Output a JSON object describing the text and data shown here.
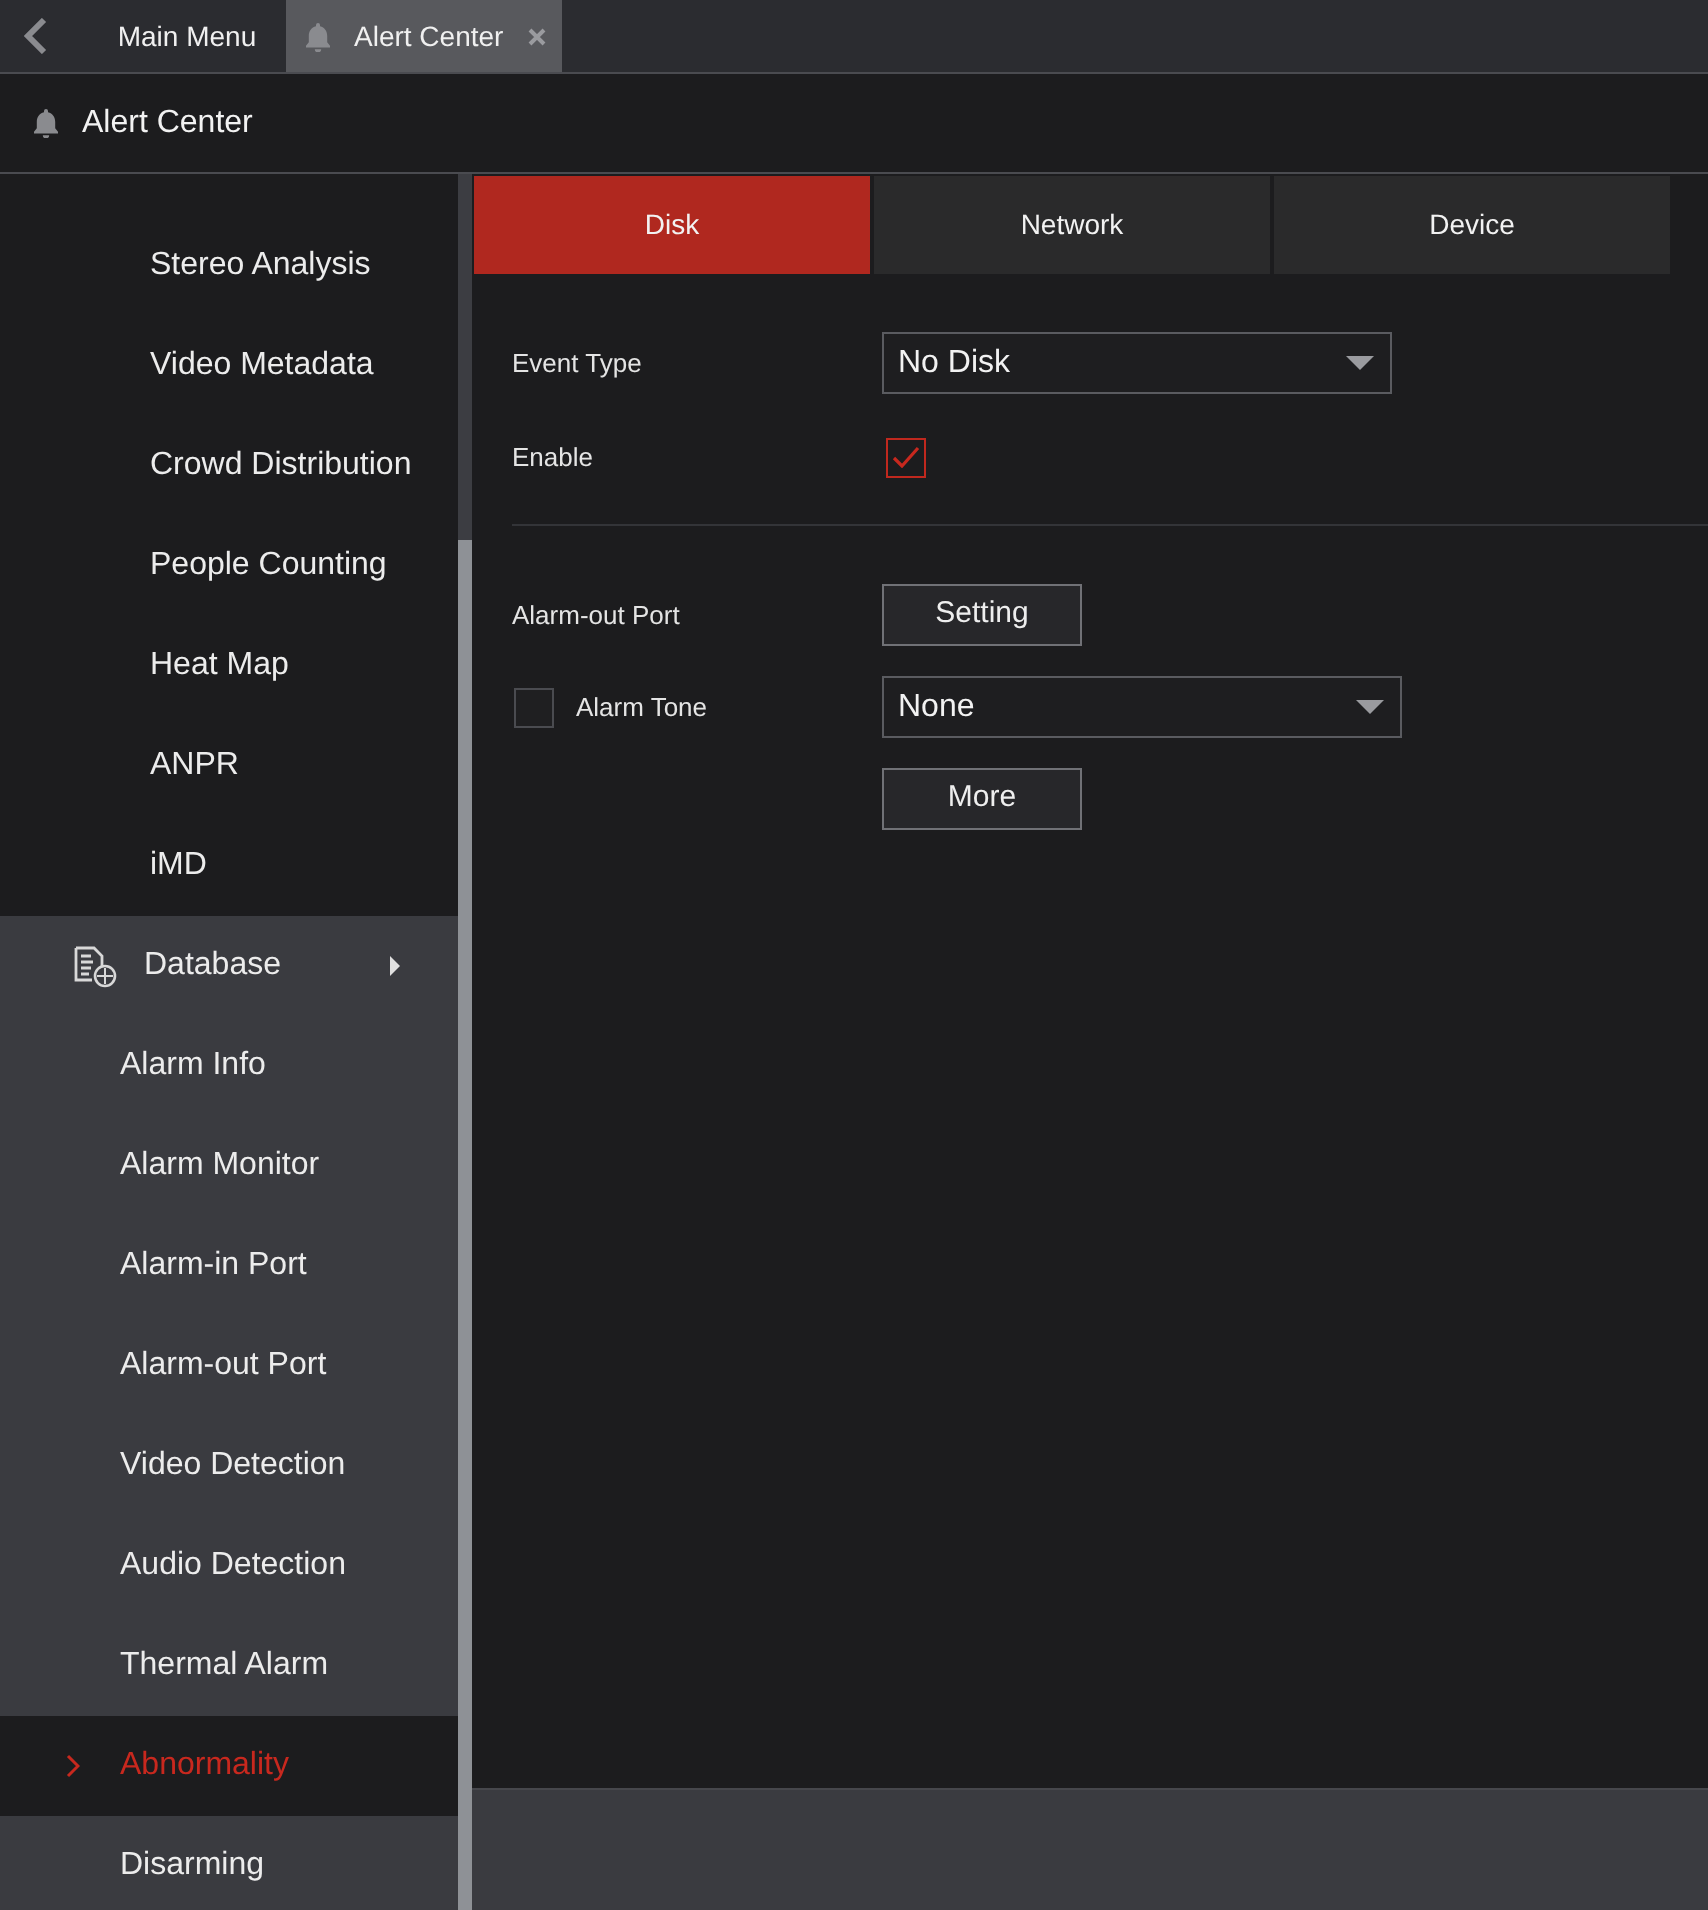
{
  "top_bar": {
    "tabs": [
      {
        "kind": "menu",
        "label": "Main Menu",
        "selected": false
      },
      {
        "kind": "page",
        "label": "Alert Center",
        "selected": true
      }
    ]
  },
  "header": {
    "title": "Alert Center"
  },
  "sidebar": {
    "items": [
      {
        "kind": "sub",
        "label": "Stereo Analysis",
        "selected": false
      },
      {
        "kind": "sub",
        "label": "Video Metadata",
        "selected": false
      },
      {
        "kind": "sub",
        "label": "Crowd Distribution",
        "selected": false
      },
      {
        "kind": "sub",
        "label": "People Counting",
        "selected": false
      },
      {
        "kind": "sub",
        "label": "Heat Map",
        "selected": false
      },
      {
        "kind": "sub",
        "label": "ANPR",
        "selected": false
      },
      {
        "kind": "sub",
        "label": "iMD",
        "selected": false
      },
      {
        "kind": "group",
        "label": "Database",
        "expanded": false,
        "selected": false
      },
      {
        "kind": "item",
        "label": "Alarm Info",
        "selected": false
      },
      {
        "kind": "item",
        "label": "Alarm Monitor",
        "selected": false
      },
      {
        "kind": "item",
        "label": "Alarm-in Port",
        "selected": false
      },
      {
        "kind": "item",
        "label": "Alarm-out Port",
        "selected": false
      },
      {
        "kind": "item",
        "label": "Video Detection",
        "selected": false
      },
      {
        "kind": "item",
        "label": "Audio Detection",
        "selected": false
      },
      {
        "kind": "item",
        "label": "Thermal Alarm",
        "selected": false
      },
      {
        "kind": "item",
        "label": "Abnormality",
        "selected": true
      },
      {
        "kind": "item",
        "label": "Disarming",
        "selected": false
      }
    ]
  },
  "content": {
    "tabs": [
      {
        "label": "Disk",
        "selected": true
      },
      {
        "label": "Network",
        "selected": false
      },
      {
        "label": "Device",
        "selected": false
      }
    ],
    "fields": [
      {
        "kind": "select",
        "label": "Event Type",
        "value": "No Disk"
      },
      {
        "kind": "checkbox",
        "label": "Enable",
        "checked": true
      }
    ],
    "alarm_fields": [
      {
        "kind": "button",
        "label": "Alarm-out Port",
        "button": "Setting"
      },
      {
        "kind": "check_select",
        "label": "Alarm Tone",
        "checked": false,
        "value": "None"
      },
      {
        "kind": "button",
        "button": "More"
      }
    ]
  }
}
